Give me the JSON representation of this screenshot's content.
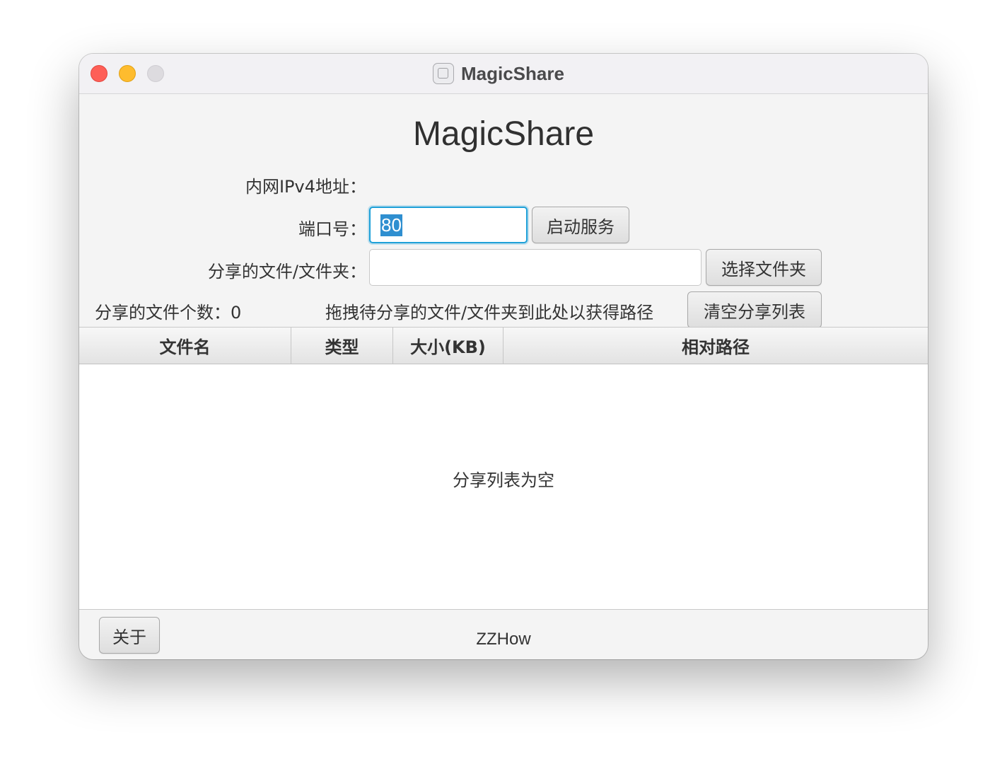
{
  "window": {
    "title": "MagicShare"
  },
  "main": {
    "heading": "MagicShare",
    "ip_label": "内网IPv4地址：",
    "ip_value": "",
    "port_label": "端口号：",
    "port_value": "80",
    "start_button": "启动服务",
    "share_path_label": "分享的文件/文件夹：",
    "share_path_value": "",
    "choose_folder_button": "选择文件夹",
    "file_count_label": "分享的文件个数：0",
    "drag_hint": "拖拽待分享的文件/文件夹到此处以获得路径",
    "clear_button": "清空分享列表"
  },
  "table": {
    "columns": [
      "文件名",
      "类型",
      "大小(KB)",
      "相对路径"
    ],
    "rows": [],
    "empty_text": "分享列表为空"
  },
  "footer": {
    "about_button": "关于",
    "credit": "ZZHow"
  },
  "colors": {
    "focus_ring": "#1ea0d8",
    "selection": "#2f8fd0",
    "close": "#fe5f57",
    "minimize": "#febc2e",
    "zoom_disabled": "#dddbdf"
  },
  "icons": [
    "close-icon",
    "minimize-icon",
    "zoom-icon",
    "app-icon"
  ]
}
